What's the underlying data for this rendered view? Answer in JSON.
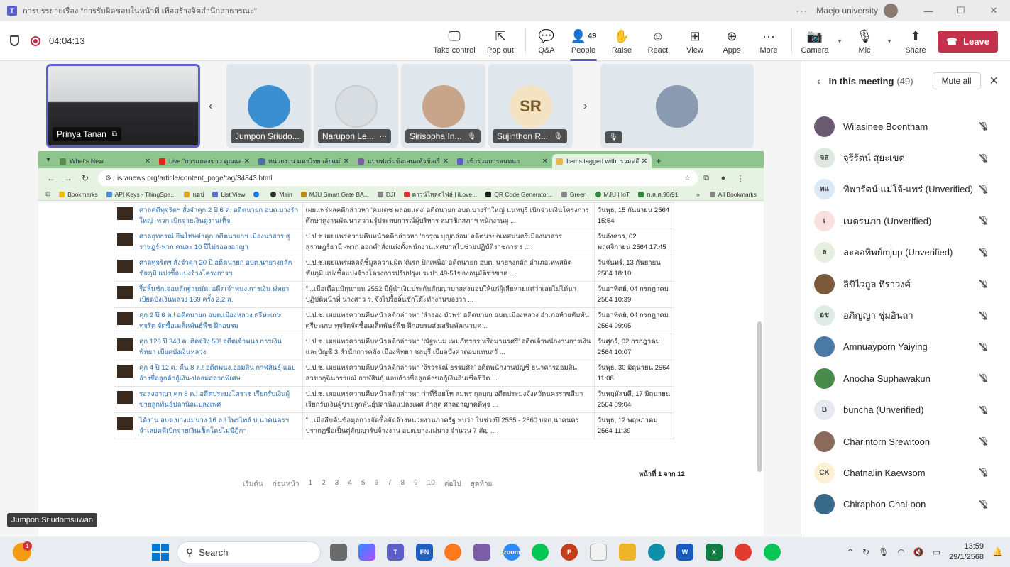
{
  "window": {
    "title": "การบรรยายเรื่อง \"การรับผิดชอบในหน้าที่ เพื่อสร้างจิตสำนึกสาธารณะ\"",
    "org": "Maejo university"
  },
  "toolbar": {
    "timer": "04:04:13",
    "buttons": [
      {
        "label": "Take control",
        "icon": "take-control-icon"
      },
      {
        "label": "Pop out",
        "icon": "pop-out-icon"
      },
      {
        "label": "Q&A",
        "icon": "qa-icon"
      },
      {
        "label": "People",
        "icon": "people-icon",
        "count": "49"
      },
      {
        "label": "Raise",
        "icon": "raise-hand-icon"
      },
      {
        "label": "React",
        "icon": "react-icon"
      },
      {
        "label": "View",
        "icon": "view-icon"
      },
      {
        "label": "Apps",
        "icon": "apps-icon"
      },
      {
        "label": "More",
        "icon": "more-icon"
      },
      {
        "label": "Camera",
        "icon": "camera-off-icon"
      },
      {
        "label": "Mic",
        "icon": "mic-off-icon"
      },
      {
        "label": "Share",
        "icon": "share-icon"
      }
    ],
    "leave": "Leave"
  },
  "strip": {
    "tiles": [
      {
        "name": "Prinya Tanan"
      },
      {
        "name": "Jumpon Sriudo..."
      },
      {
        "name": "Narupon Le..."
      },
      {
        "name": "Sirisopha In..."
      },
      {
        "name": "Sujinthon R...",
        "initials": "SR"
      },
      {
        "name": ""
      }
    ]
  },
  "browser": {
    "tabs": [
      {
        "title": "What's New",
        "color": "#5a8a4a"
      },
      {
        "title": "Live \"การแถลงข่าว คุณแสงนะ\"",
        "color": "#e62117"
      },
      {
        "title": "หน่วยงาน มหาวิทยาลัยแม่โจ้",
        "color": "#4a6fa5"
      },
      {
        "title": "แบบฟอร์มข้อเสนอหัวข้อเรื่อง \"ก",
        "color": "#7b5ea7"
      },
      {
        "title": "เข้าร่วมการสนทนา",
        "color": "#5b5fc7"
      },
      {
        "title": "Items tagged with: รวมคดีทุ",
        "color": "#e8b84a"
      }
    ],
    "url": "isranews.org/article/content_page/tag/34843.html",
    "bookmarks": [
      "Bookmarks",
      "API Keys - ThingSpe...",
      "แอป",
      "List View",
      "",
      "Main",
      "MJU Smart Gate BA...",
      "DJI",
      "ดาวน์โหลดไฟล์ | iLove...",
      "QR Code Generator...",
      "Green",
      "MJU | IoT",
      "ก.ล.ต.90/91"
    ],
    "all_bookmarks": "All Bookmarks",
    "rows": [
      {
        "title": "ศาลคดีทุจริตฯ สั่งจำคุก 2 ปี 6 ด. อดีตนายก อบต.บางรักใหญ่ -พวก เบิกจ่ายเงินดูงานเท็จ",
        "desc": "เผยแพร่ผลคดีกล่าวหา 'คมเดช พลอยแดง' อดีตนายก อบต.บางรักใหญ่ นนทบุรี เบิกจ่ายเงินโครงการศึกษาดูงานพัฒนาความรู้ประสบการณ์ผู้บริหาร สมาชิกสภาฯ พนักงานผู ...",
        "date": "วันพุธ, 15 กันยายน 2564 15:54"
      },
      {
        "title": "ศาลอุทธรณ์ ยืนโทษจำคุก อดีตนายกฯ เมืองนาสาร สุราษฎร์-พวก คนละ 10 ปีไม่รอลงอาญา",
        "desc": "ป.ป.ช.เผยแพร่ความคืบหน้าคดีกล่าวหา 'การุณ บุญกล่อม' อดีตนายกเทศมนตรีเมืองนาสาร สุราษฎร์ธานี -พวก ออกคำสั่งแต่งตั้งพนักงานเทศบาลไปช่วยปฏิบัติราชการ ร ...",
        "date": "วันอังคาร, 02 พฤศจิกายน 2564 17:45"
      },
      {
        "title": "ศาลทุจริตฯ สั่งจำคุก 20 ปี อดีตนายก อบต.นายางกลัก ชัยภูมิ แบ่งซื้อแบ่งจ้างโครงการฯ",
        "desc": "ป.ป.ช.เผยแพร่ผลคดีชี้มูลความผิด 'ดิเรก ปิกเหนือ' อดีตนายก อบต. นายางกลัก อำเภอเทพสถิต ชัยภูมิ แบ่งซื้อแบ่งจ้างโครงการปรับปรุงประปา 49-51ของอนุมัติซ่าขาด ...",
        "date": "วันจันทร์, 13 กันยายน 2564 18:10"
      },
      {
        "title": "รื้อสิ้นชักเจอหลักฐานมัด! อดีตเจ้าพนง.การเงิน พัทยา เบียดบังเงินหลวง 169 ครั้ง 2.2 ล.",
        "desc": "\"...เมื่อเดือนมิถุนายน 2552 มีผู้นำเงินประกันสัญญาบาสส่งมอบให้แก่ผู้เสียหายแต่ว่าเลยไม่ได้นาปฏิบัติหน้าที่ นางสาว ร. จึงไปรื้อลิ้นชักโต๊ะทำงานของว่า ...",
        "date": "วันอาทิตย์, 04 กรกฎาคม 2564 10:39"
      },
      {
        "title": "คุก 2 ปี 6 ด.! อดีตนายก อบต.เมืองหลวง ศรีษะเกษ ทุจริต จัดซื้อเมล็ดพันธุ์พืช-ฝึกอบรม",
        "desc": "ป.ป.ช. เผยแพร่ความคืบหน้าคดีกล่าวหา 'สำรอง บัวพร' อดีตนายก อบต.เมืองหลวง อำเภอห้วยทับทัน ศรีษะเกษ ทุจริตจัดซื้อเมล็ดพันธุ์พืช-ฝึกอบรมส่งเสริมพัฒนาบุค ...",
        "date": "วันอาทิตย์, 04 กรกฎาคม 2564 09:05"
      },
      {
        "title": "คุก 128 ปี 348 ด. ติดจริง 50! อดีตเจ้าพนง.การเงิน พัทยา เบียดบังเงินหลวง",
        "desc": "ป.ป.ช. เผยแพร่ความคืบหน้าคดีกล่าวหา 'ณัฐพนม เหมภัทรธร หรือมานรศรี' อดีตเจ้าพนักงานการเงินและบัญชี 3 สำนักการคลัง เมืองพัทยา ชลบุรี เบียดบังค่าตอบแทนสวั ...",
        "date": "วันศุกร์, 02 กรกฎาคม 2564 10:07"
      },
      {
        "title": "คุก 4 ปี 12 ด.-คืน 8 ล.! อดีตพนง.ออมสิน กาฬสินธุ์ แอบอ้างชื่อลูกค้ากู้เงิน-ปลอมสลากพิเศษ",
        "desc": "ป.ป.ช. เผยแพร่ความคืบหน้าคดีกล่าวหา 'จีรวรรณ์ ธรรมศิล' อดีตพนักงานบัญชี ธนาคารออมสิน สาขากุฉินารายณ์ กาฬสินธุ์ แอบอ้างชื่อลูกค้าขอกู้เงินสินเชื่อชีวิต ...",
        "date": "วันพุธ, 30 มิถุนายน 2564 11:08"
      },
      {
        "title": "รอลงอาญา คุก 8 ด.! อดีตประมงโคราช เรียกรับเงินผู้ขายลูกพันธุ์ปลานิลแปลงเพศ",
        "desc": "ป.ป.ช. เผยแพร่ความคืบหน้าคดีกล่าวหา ว่าที่ร้อยโท สมพร กุลบุญ อดีตประมงจังหวัดนครราชสีมา เรียกรับเงินผู้ขายลูกพันธุ์ปลานิลแปลงเพศ ลำสุด ศาลอาญาคดีทุจ ...",
        "date": "วันพฤหัสบดี, 17 มิถุนายน 2564 09:04"
      },
      {
        "title": "ได้งาน อบต.บางแม่นาง 16 ล.! ไพรไพล์ บ.นาคนครฯ จำเลยคดีเบิกจ่ายเงินเช็คโดยไม่มีฎีกา",
        "desc": "\"...เมื่อสืบค้นข้อมูลการจัดซื้อจัดจ้างหน่วยงานภาครัฐ พบว่า ในช่วงปี 2555 - 2560 บจก.นาคนคร ปรากฏชื่อเป็นคู่สัญญารับจ้างงาน อบต.บางแม่นาง จำนวน 7 สัญ ...",
        "date": "วันพุธ, 12 พฤษภาคม 2564 11:39"
      }
    ],
    "page_info": "หน้าที่ 1 จาก 12",
    "pager": [
      "เริ่มต้น",
      "ก่อนหน้า",
      "1",
      "2",
      "3",
      "4",
      "5",
      "6",
      "7",
      "8",
      "9",
      "10",
      "ต่อไป",
      "สุดท้าย"
    ]
  },
  "panel": {
    "title": "In this meeting",
    "count": "(49)",
    "mute_all": "Mute all",
    "people": [
      {
        "name": "Wilasinee Boontham",
        "initials": "",
        "color": "#6b5a70"
      },
      {
        "name": "จุรีรัตน์ สุยะเขต",
        "initials": "จส",
        "color": "#dfe8df"
      },
      {
        "name": "ทิพารัตน์ แม่โจ้-แพร่ (Unverified)",
        "initials": "ทแ",
        "color": "#dbe9f7"
      },
      {
        "name": "เนตรนภา (Unverified)",
        "initials": "เ",
        "color": "#fbe0e0"
      },
      {
        "name": "ละออทิพย์mjup (Unverified)",
        "initials": "ล",
        "color": "#e6efe0"
      },
      {
        "name": "ลิขิไวกูล ทิราวงศ์",
        "initials": "",
        "color": "#7a5a3a"
      },
      {
        "name": "อภิญญา ชุ่มอินถา",
        "initials": "อช",
        "color": "#dfece6"
      },
      {
        "name": "Amnuayporn Yaiying",
        "initials": "",
        "color": "#4a7aa5"
      },
      {
        "name": "Anocha Suphawakun",
        "initials": "",
        "color": "#4a8a4a"
      },
      {
        "name": "buncha (Unverified)",
        "initials": "B",
        "color": "#e6e9ef"
      },
      {
        "name": "Charintorn Srewitoon",
        "initials": "",
        "color": "#8a6a5a"
      },
      {
        "name": "Chatnalin Kaewsom",
        "initials": "CK",
        "color": "#fbf0d0"
      },
      {
        "name": "Chiraphon Chai-oon",
        "initials": "",
        "color": "#3a6a8a"
      }
    ]
  },
  "hover_name": "Jumpon Sriudomsuwan",
  "taskbar": {
    "search": "Search",
    "weather_badge": "1",
    "time": "13:59",
    "date": "29/1/2568"
  }
}
